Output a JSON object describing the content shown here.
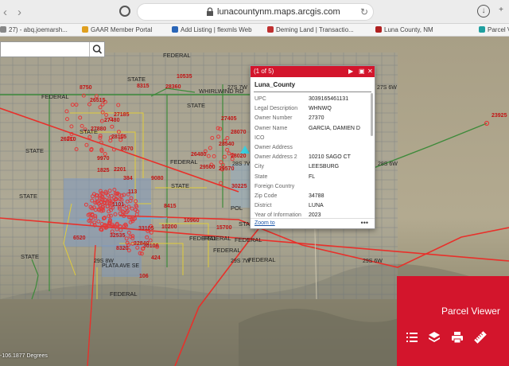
{
  "browser": {
    "url": "lunacountynm.maps.arcgis.com",
    "back_glyph": "‹",
    "forward_glyph": "›",
    "reload_glyph": "↻",
    "bookmarks": [
      {
        "label": "27) - abq.joemarsh...",
        "color": "#888888"
      },
      {
        "label": "GAAR Member Portal",
        "color": "#e0a020"
      },
      {
        "label": "Add Listing | flexmls Web",
        "color": "#2a66b8"
      },
      {
        "label": "Deming Land | Transactio...",
        "color": "#c03030"
      },
      {
        "label": "Luna County, NM",
        "color": "#b02020"
      },
      {
        "label": "Parcel Vi",
        "color": "#20a0a0"
      }
    ]
  },
  "search": {
    "placeholder": "",
    "value": "",
    "icon": "search-icon"
  },
  "popup": {
    "counter": "(1 of 5)",
    "layer": "Luna_County",
    "fields": [
      {
        "key": "UPC",
        "value": "3039165461131"
      },
      {
        "key": "Legal Description",
        "value": "WHNWQ"
      },
      {
        "key": "Owner Number",
        "value": "27370"
      },
      {
        "key": "Owner Name",
        "value": "GARCIA, DAMIEN D"
      },
      {
        "key": "ICO",
        "value": ""
      },
      {
        "key": "Owner Address",
        "value": ""
      },
      {
        "key": "Owner Address 2",
        "value": "10210 SAGO CT"
      },
      {
        "key": "City",
        "value": "LEESBURG"
      },
      {
        "key": "State",
        "value": "FL"
      },
      {
        "key": "Foreign Country",
        "value": ""
      },
      {
        "key": "Zip Code",
        "value": "34788"
      },
      {
        "key": "District",
        "value": "LUNA"
      },
      {
        "key": "Year of Information",
        "value": "2023"
      }
    ],
    "zoom_label": "Zoom to",
    "more_label": "•••"
  },
  "parcel_viewer": {
    "title": "Parcel Viewer"
  },
  "map": {
    "scale_text": "-106.1877 Degrees",
    "land_labels": [
      {
        "text": "FEDERAL"
      },
      {
        "text": "STATE"
      },
      {
        "text": "WHIRLWIND RD"
      },
      {
        "text": "STATE"
      },
      {
        "text": "FEDERAL"
      },
      {
        "text": "STATE"
      },
      {
        "text": "FEDERAL"
      },
      {
        "text": "STATE"
      },
      {
        "text": "FEDERAL"
      },
      {
        "text": "STATE"
      },
      {
        "text": "STATE"
      },
      {
        "text": "FEDERAL"
      },
      {
        "text": "FEDERAL"
      },
      {
        "text": "FEDERAL"
      },
      {
        "text": "STATE"
      },
      {
        "text": "FEDERAL"
      },
      {
        "text": "FEDERAL"
      },
      {
        "text": "STATE"
      },
      {
        "text": "POL"
      },
      {
        "text": "FEDERAL"
      },
      {
        "text": "PLATA AVE SE"
      }
    ],
    "township_labels": [
      "27S 7W",
      "27S 6W",
      "28S 7W",
      "28S 6W",
      "29S 8W",
      "29S 7W",
      "29S 6W"
    ],
    "parcel_numbers": [
      "8315",
      "10535",
      "28360",
      "8750",
      "26515",
      "27480",
      "27185",
      "27880",
      "28115",
      "26210",
      "8670",
      "9970",
      "2201",
      "9080",
      "384",
      "1825",
      "113",
      "27405",
      "28070",
      "28540",
      "26480",
      "29500",
      "29570",
      "28020",
      "30225",
      "10960",
      "32535",
      "33105",
      "32840",
      "30100",
      "10200",
      "8320",
      "424",
      "106",
      "6520",
      "23925",
      "15700",
      "8415",
      "1101"
    ],
    "colors": {
      "parcel": "#e23b3b",
      "road": "#e8302a",
      "state_line": "#3d8a3a",
      "boundary": "#e0cc3a",
      "parcel_fill": "#8aa6c6"
    }
  }
}
